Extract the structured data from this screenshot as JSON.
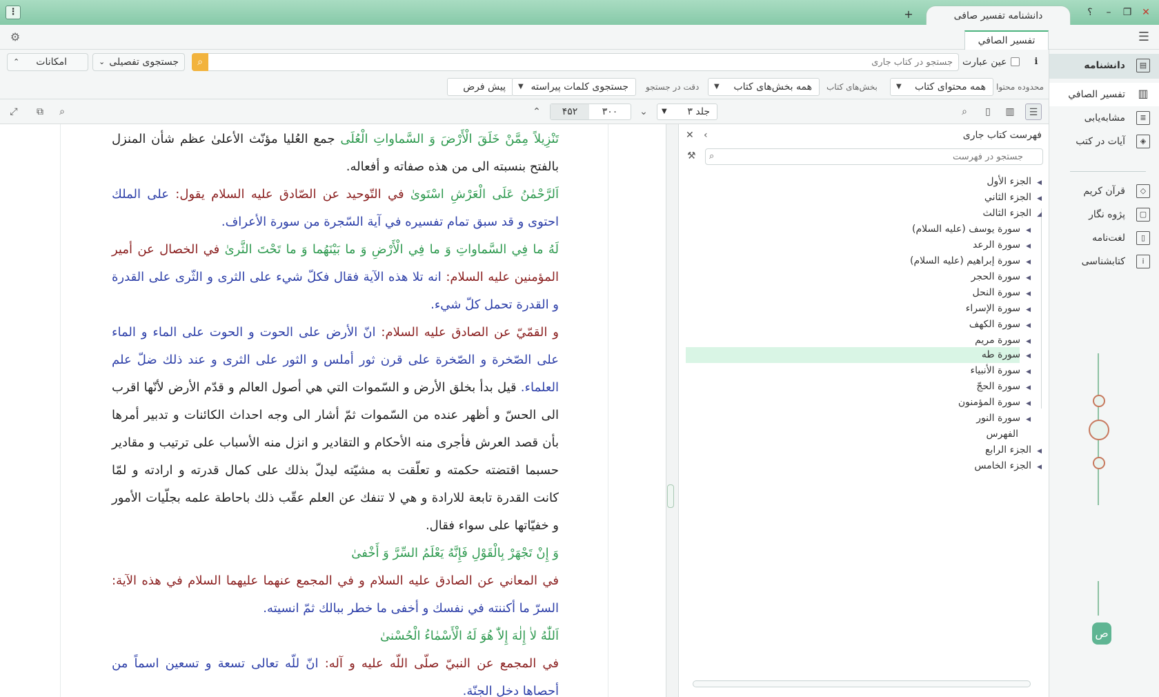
{
  "titlebar": {
    "app_title": "دانشنامه تفسیر صافی",
    "new_tab": "+",
    "menu_glyph": "⋮",
    "help": "؟",
    "minimize": "–",
    "restore": "❐",
    "close": "✕"
  },
  "tabs": {
    "active_doc": "تفسير الصافي"
  },
  "search": {
    "placeholder": "جستجو در کتاب جاری",
    "exact_label": "عین عبارت",
    "info": "i",
    "detailed_search": "جستجوی تفصیلی",
    "features": "امکانات"
  },
  "filters": {
    "scope_label": "محدوده محتوا",
    "scope_value": "همه محتوای کتاب",
    "sections_label": "بخش‌های کتاب",
    "sections_value": "همه بخش‌های کتاب",
    "precision_label": "دقت در جستجو",
    "precision_value": "جستجوی کلمات پیراسته",
    "default_button": "پیش فرض"
  },
  "toolbar": {
    "volume": "جلد ۳",
    "current_page": "۳۰۰",
    "total_pages": "۴۵۲"
  },
  "content": {
    "p1_q": "تَنْزِيلاً مِمَّنْ خَلَقَ الْأَرْضَ وَ السَّماواتِ الْعُلَى",
    "p1_c": " جمع العُليا مؤنّث الأعلىٰ عظم شأن المنزل بالفتح بنسبته الى من هذه صفاته و أفعاله.",
    "p2_q": "اَلرَّحْمٰنُ عَلَى الْعَرْشِ اسْتَوىٰ",
    "p2_h": " في التّوحيد عن الصّادق عليه السلام يقول:",
    "p2_c": " على الملك احتوى و قد سبق تمام تفسيره في آية السّجرة من سورة الأعراف.",
    "p3_q": "لَهُ ما فِي السَّماواتِ وَ ما فِي الْأَرْضِ وَ ما بَيْنَهُما وَ ما تَحْتَ الثَّرىٰ",
    "p3_h": " في الخصال عن أمير المؤمنين عليه السلام:",
    "p3_c": " انه تلا هذه الآية فقال فكلّ شيء على الثرى و الثّرى على القدرة و القدرة تحمل كلّ شيء.",
    "p4_h": "و القمّيّ عن الصادق عليه السلام:",
    "p4_c": " انّ الأرض على الحوت و الحوت على الماء و الماء على الصّخرة و الصّخرة على قرن ثور أملس و الثور على الثرى و عند ذلك ضلّ علم العلماء.",
    "p4_t": " قيل بدأ بخلق الأرض و السّموات التي هي أصول العالم و قدّم الأرض لأنّها اقرب الى الحسّ و أظهر عنده من السّموات ثمّ أشار الى وجه احداث الكائنات و تدبير أمرها بأن قصد العرش فأجرى منه الأحكام و التقادير و انزل منه الأسباب على ترتيب و مقادير حسبما اقتضته حكمته و تعلّقت به مشيّته ليدلّ بذلك على كمال قدرته و ارادته و لمّا كانت القدرة تابعة للارادة و هي لا تنفك عن العلم عقّب ذلك باحاطة علمه بجلّيات الأمور و خفيّاتها على سواء فقال.",
    "p5_q": "وَ إِنْ تَجْهَرْ بِالْقَوْلِ فَإِنَّهُ يَعْلَمُ السِّرَّ وَ أَخْفىٰ",
    "p6_h": "في المعاني عن الصادق عليه السلام و في المجمع عنهما عليهما السلام في هذه الآية:",
    "p6_c": " السرّ ما أكننته في نفسك و أخفى ما خطر ببالك ثمّ انسيته.",
    "p7_q": "اَللّٰهُ لاٰ إِلٰهَ إِلاّٰ هُوَ لَهُ الْأَسْمٰاءُ الْحُسْنىٰ",
    "p8_h": "في المجمع عن النبيّ صلّى اللّه عليه و آله:",
    "p8_c": " انّ للّه تعالى تسعة و تسعين اسماً من أحصاها دخل الجنّة."
  },
  "index": {
    "title": "فهرست کتاب جاری",
    "search_placeholder": "جستجو در فهرست",
    "items": [
      "الجزء الأول",
      "الجزء الثاني",
      "الجزء الثالث",
      "سورة يوسف (عليه السلام)",
      "سورة الرعد",
      "سورة إبراهيم (عليه السلام)",
      "سورة الحجر",
      "سورة النحل",
      "سورة الإسراء",
      "سورة الكهف",
      "سورة مريم",
      "سورة طه",
      "سورة الأنبياء",
      "سورة الحجّ",
      "سورة المؤمنون",
      "سورة النور",
      "الفهرس",
      "الجزء الرابع",
      "الجزء الخامس"
    ],
    "selected": "سورة طه"
  },
  "sidebar": {
    "items": [
      "دانشنامه",
      "تفسير الصافي",
      "مشابه‌یابی",
      "آیات در کتب",
      "قرآن کریم",
      "پژوه نگار",
      "لغت‌نامه",
      "کتابشناسی"
    ]
  },
  "colors": {
    "quran": "#2f9a50",
    "hadith": "#8a1f1f",
    "commentary": "#2d3fa8",
    "accent": "#86c9a8",
    "selection": "#d9f5e5"
  }
}
